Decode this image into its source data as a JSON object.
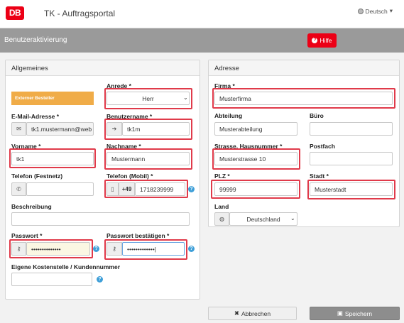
{
  "header": {
    "logo_text": "DB",
    "portal_title": "TK - Auftragsportal",
    "language": "Deutsch"
  },
  "titlebar": {
    "title": "Benutzeraktivierung",
    "help_label": "Hilfe"
  },
  "general": {
    "heading": "Allgemeines",
    "external_badge": "Externer Besteller",
    "anrede": {
      "label": "Anrede *",
      "value": "Herr"
    },
    "email": {
      "label": "E-Mail-Adresse *",
      "value": "tk1.mustermann@web"
    },
    "username": {
      "label": "Benutzername *",
      "value": "tk1m"
    },
    "vorname": {
      "label": "Vorname *",
      "value": "tk1"
    },
    "nachname": {
      "label": "Nachname *",
      "value": "Mustermann"
    },
    "phone_landline": {
      "label": "Telefon (Festnetz)",
      "value": ""
    },
    "phone_mobile": {
      "label": "Telefon (Mobil) *",
      "prefix": "+49",
      "value": "1718239999"
    },
    "description": {
      "label": "Beschreibung",
      "value": ""
    },
    "password": {
      "label": "Passwort *",
      "value": "••••••••••••••"
    },
    "password_confirm": {
      "label": "Passwort bestätigen *",
      "value": "•••••••••••••|"
    },
    "cost_center": {
      "label": "Eigene Kostenstelle / Kundennummer",
      "value": ""
    }
  },
  "address": {
    "heading": "Adresse",
    "firma": {
      "label": "Firma *",
      "value": "Musterfirma"
    },
    "abteilung": {
      "label": "Abteilung",
      "value": "Musterabteilung"
    },
    "buero": {
      "label": "Büro",
      "value": ""
    },
    "strasse": {
      "label": "Strasse, Hausnummer *",
      "value": "Musterstrasse 10"
    },
    "postfach": {
      "label": "Postfach",
      "value": ""
    },
    "plz": {
      "label": "PLZ *",
      "value": "99999"
    },
    "stadt": {
      "label": "Stadt *",
      "value": "Musterstadt"
    },
    "land": {
      "label": "Land",
      "value": "Deutschland"
    }
  },
  "actions": {
    "cancel_label": "Abbrechen",
    "save_label": "Speichern"
  },
  "colors": {
    "brand_red": "#ec0016",
    "highlight": "#e03a4a",
    "badge_orange": "#f0ac48",
    "help_blue": "#3e9fd8"
  }
}
